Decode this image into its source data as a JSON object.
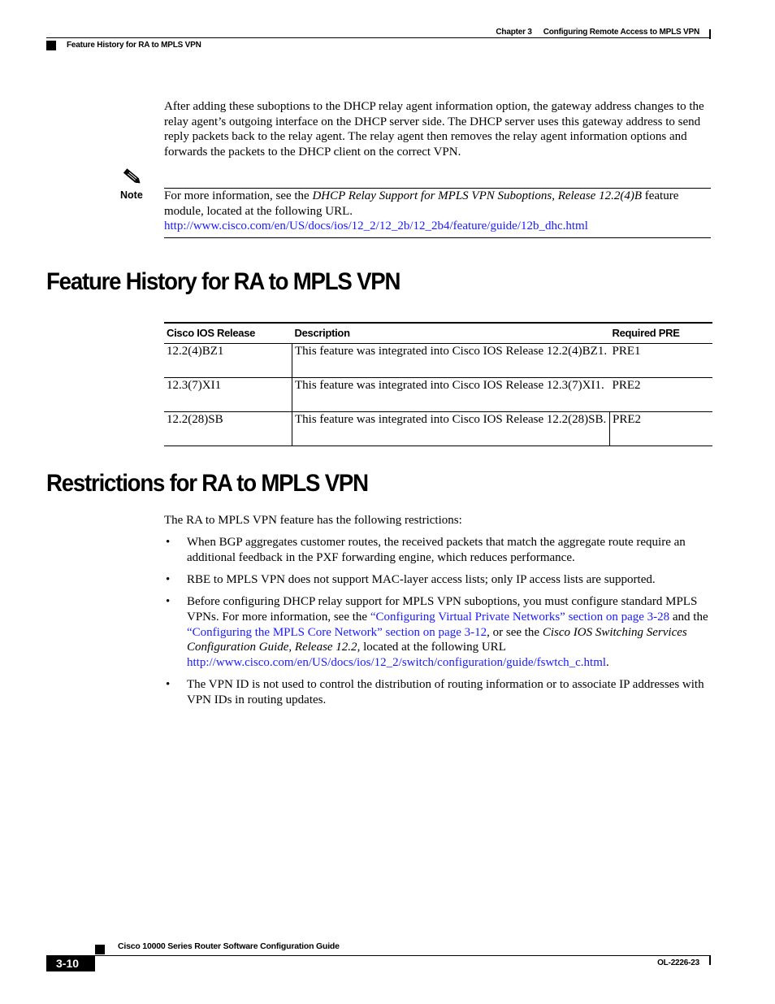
{
  "running_header": {
    "chapter": "Chapter 3",
    "chapter_title": "Configuring Remote Access to MPLS VPN",
    "section": "Feature History for RA to MPLS VPN"
  },
  "intro_paragraph": "After adding these suboptions to the DHCP relay agent information option, the gateway address changes to the relay agent’s outgoing interface on the DHCP server side. The DHCP server uses this gateway address to send reply packets back to the relay agent. The relay agent then removes the relay agent information options and forwards the packets to the DHCP client on the correct VPN.",
  "note": {
    "icon": "pencil-note-icon",
    "label": "Note",
    "text_before": "For more information, see the ",
    "italic_title": "DHCP Relay Support for MPLS VPN Suboptions, Release 12.2(4)B",
    "text_after": " feature module, located at the following URL.",
    "url": "http://www.cisco.com/en/US/docs/ios/12_2/12_2b/12_2b4/feature/guide/12b_dhc.html"
  },
  "feature_history": {
    "heading": "Feature History for RA to MPLS VPN",
    "columns": [
      "Cisco IOS Release",
      "Description",
      "Required PRE"
    ],
    "rows": [
      {
        "release": "12.2(4)BZ1",
        "description": "This feature was integrated into Cisco IOS Release 12.2(4)BZ1.",
        "pre": "PRE1"
      },
      {
        "release": "12.3(7)XI1",
        "description": "This feature was integrated into Cisco IOS Release 12.3(7)XI1.",
        "pre": "PRE2"
      },
      {
        "release": "12.2(28)SB",
        "description": "This feature was integrated into Cisco IOS Release 12.2(28)SB.",
        "pre": "PRE2"
      }
    ]
  },
  "restrictions": {
    "heading": "Restrictions for RA to MPLS VPN",
    "intro": "The RA to MPLS VPN feature has the following restrictions:",
    "bullet_glyph": "•",
    "item1": "When BGP aggregates customer routes, the received packets that match the aggregate route require an additional feedback in the PXF forwarding engine, which reduces performance.",
    "item2": "RBE to MPLS VPN does not support MAC-layer access lists; only IP access lists are supported.",
    "item3": {
      "text1": "Before configuring DHCP relay support for MPLS VPN suboptions, you must configure standard MPLS VPNs. For more information, see the ",
      "link1": "“Configuring Virtual Private Networks” section on page 3-28",
      "text2": " and the ",
      "link2": "“Configuring the MPLS Core Network” section on page 3-12",
      "text3": ", or see the ",
      "italic": "Cisco IOS Switching Services Configuration Guide, Release 12.2",
      "text4": ", located at the following URL ",
      "url": "http://www.cisco.com/en/US/docs/ios/12_2/switch/configuration/guide/fswtch_c.html",
      "text5": "."
    },
    "item4": "The VPN ID is not used to control the distribution of routing information or to associate IP addresses with VPN IDs in routing updates."
  },
  "footer": {
    "guide_title": "Cisco 10000 Series Router Software Configuration Guide",
    "page_number": "3-10",
    "doc_number": "OL-2226-23"
  },
  "colors": {
    "link": "#1a1aff",
    "text": "#000000"
  }
}
